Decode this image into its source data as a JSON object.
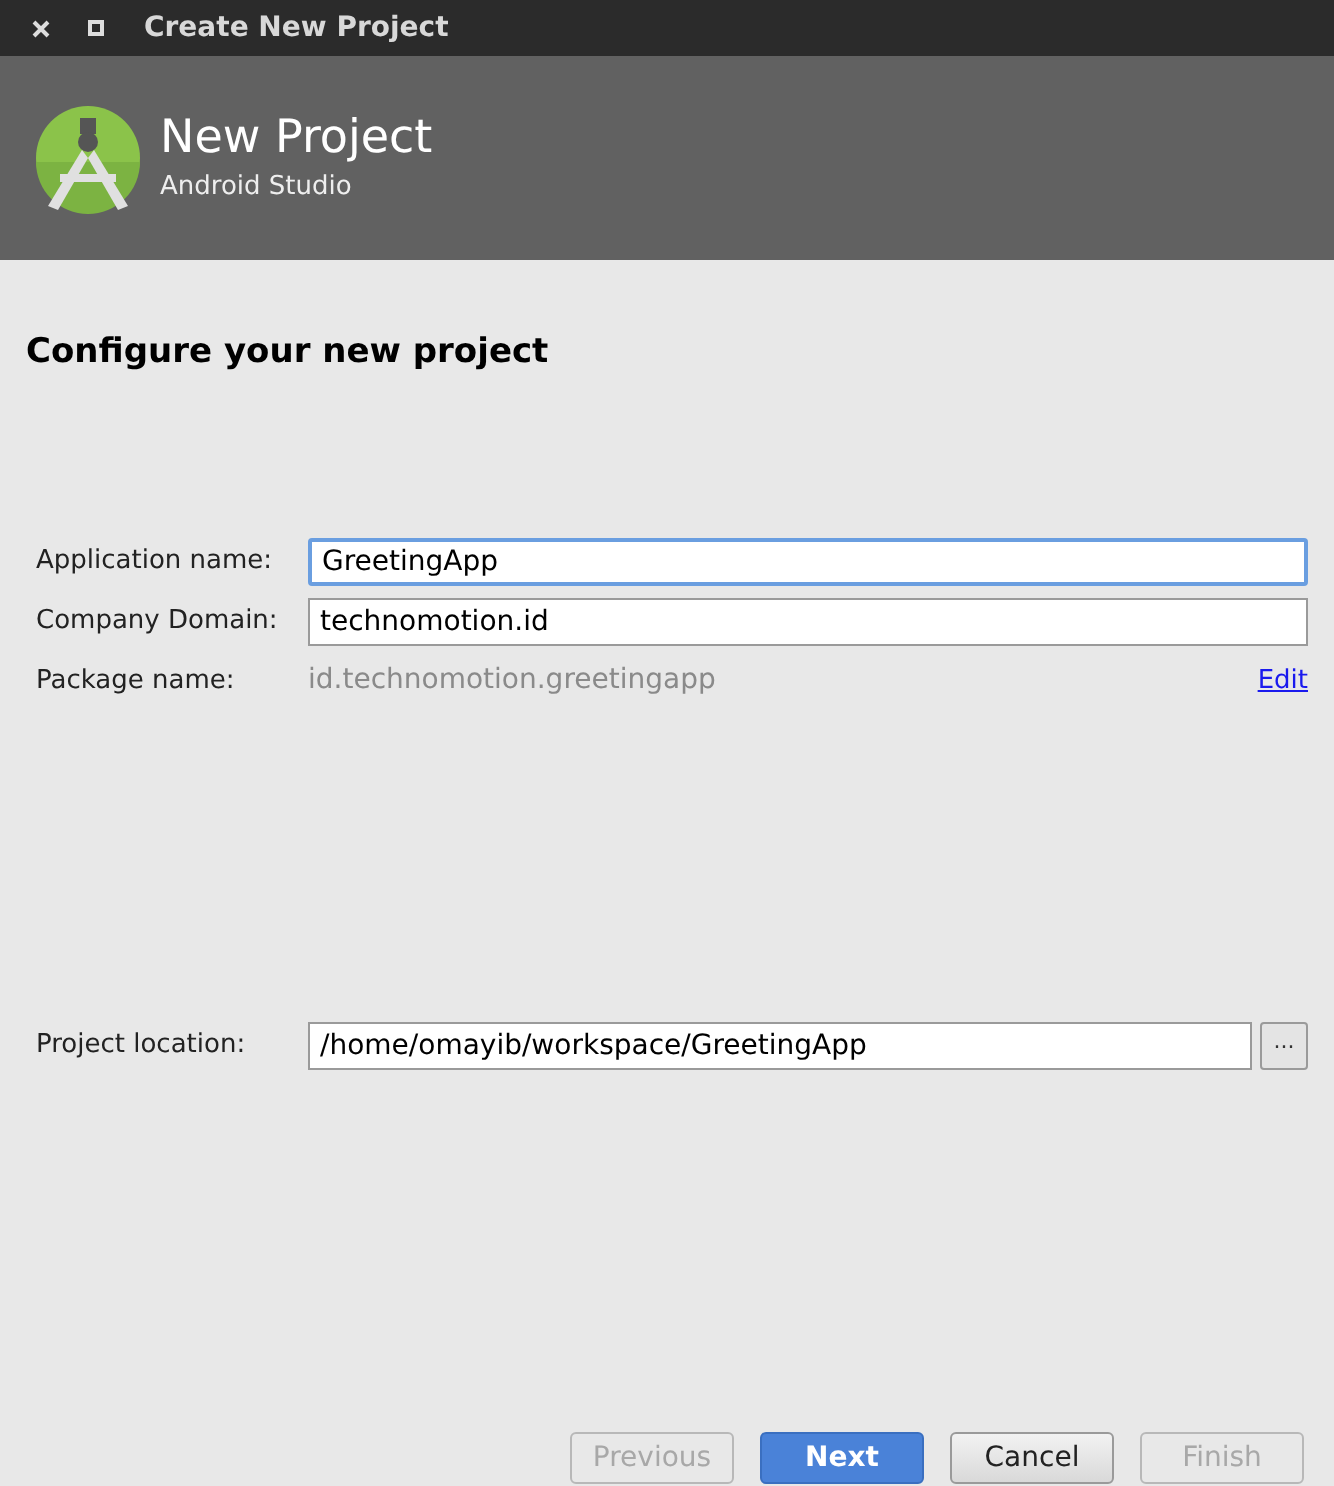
{
  "window": {
    "title": "Create New Project"
  },
  "header": {
    "title": "New Project",
    "subtitle": "Android Studio"
  },
  "heading": "Configure your new project",
  "fields": [
    {
      "label": "Application name:",
      "value": "GreetingApp",
      "focused": true
    },
    {
      "label": "Company Domain:",
      "value": "technomotion.id",
      "focused": false
    }
  ],
  "package": {
    "label": "Package name:",
    "value": "id.technomotion.greetingapp",
    "link": "Edit"
  },
  "location": {
    "label": "Project location:",
    "value": "/home/omayib/workspace/GreetingApp",
    "browse": "..."
  },
  "buttons": [
    {
      "label": "Previous",
      "disabled": true,
      "primary": false
    },
    {
      "label": "Next",
      "disabled": false,
      "primary": true
    },
    {
      "label": "Cancel",
      "disabled": false,
      "primary": false
    },
    {
      "label": "Finish",
      "disabled": true,
      "primary": false
    }
  ]
}
